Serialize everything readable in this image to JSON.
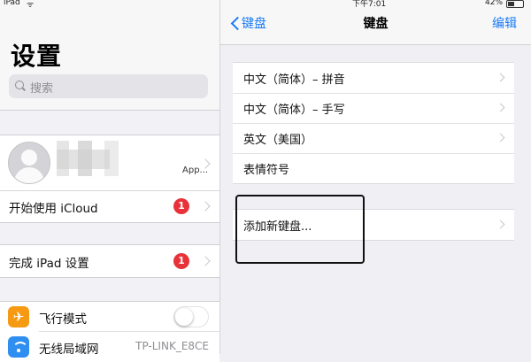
{
  "status_bar": {
    "carrier": "iPad",
    "time": "下午7:01",
    "battery": "42%"
  },
  "settings": {
    "title": "设置",
    "search": {
      "placeholder": "搜索"
    },
    "profile": {
      "name_fragment": "App..."
    },
    "rows": [
      {
        "label": "开始使用 iCloud",
        "badge": "1"
      },
      {
        "label": "完成 iPad 设置",
        "badge": "1"
      },
      {
        "label": "飞行模式",
        "toggle": "off"
      },
      {
        "label": "无线局域网",
        "value": "TP-LINK_E8CE"
      }
    ]
  },
  "keyboards": {
    "back_label": "键盘",
    "title": "键盘",
    "edit_label": "编辑",
    "items": [
      {
        "label": "中文（简体）– 拼音"
      },
      {
        "label": "中文（简体）– 手写"
      },
      {
        "label": "英文（美国）"
      },
      {
        "label": "表情符号"
      }
    ],
    "add_label": "添加新键盘..."
  },
  "colors": {
    "accent": "#1a7cf5",
    "badge": "#e8323a",
    "airplane": "#f59a12",
    "wifi": "#2f8ff0"
  }
}
